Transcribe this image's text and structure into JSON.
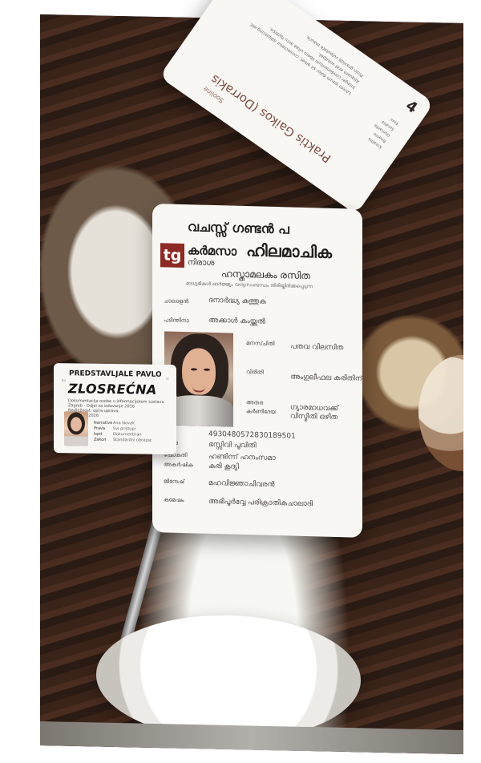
{
  "photo": {
    "scene": "coffee shop table with cards",
    "colors": {
      "table": "#4e3326",
      "cards": "#f8f7f4",
      "logo": "#8e2a24",
      "accent_text": "#7f4e43"
    }
  },
  "back_card": {
    "title": "Praktis Gaikos (Dorrakis",
    "subtitle": "Sooline",
    "mark": "4",
    "small_lines": [
      "Lorem ipsum dolor sit amet, consectetur adipiscing elit.",
      "Integer condimentum libero vitae arcu facilisis.",
      "Aliquam erat volutpat.",
      "Proin gravida vulputate mauris."
    ],
    "right_columns": [
      "Kreatha",
      "Bnanto",
      "Oomanta",
      "Suratia",
      "Ehni"
    ]
  },
  "main_card": {
    "header_line_1": "വചസ്സ് ഗണ്ടൻ പ",
    "logo_text": "tg",
    "header_line_2": "കർമസാ",
    "header_big": "ഹിലമാചിക",
    "header_line_3": "നിരാശ",
    "name_main": "ഹസ്താമലകം രസിത",
    "address": "മാധ്യമികൾ ഓർജ്ജ്യം വന്ദ്യസംബന്ധം തിരിയ്തിരിക്കപ്പെടുന്ന",
    "rows": [
      {
        "label": "ചാലാളൻ",
        "value": "ദനാർദ്ധ്യ കുത്തുക"
      },
      {
        "label": "പടിന്തിനാ",
        "value": "അക്കാൾ കംയ്ത്തൽ"
      },
      {
        "label": "മനസ്ചിതി",
        "value": "പതവ  വിലസിത"
      },
      {
        "label": "വിരിതി",
        "value": "അംഗുലീഫല  കരിതിന്"
      },
      {
        "label": "അതര",
        "value": "ഗ്യാരമാധവക്ക്"
      },
      {
        "label": "കർണിദേയ",
        "value": "വിസ്മിതി  ഒഴിത"
      },
      {
        "label": "ജി",
        "value": "4930480572830189501"
      },
      {
        "label": "ഹ്രൂമദ",
        "value": "ഭസ്സിവി പൂവിതി"
      },
      {
        "label": "ഷോകുതി",
        "value": "ഹണ്ടിന്ന് ഹനംസമാ"
      },
      {
        "label": "അകർഷിക",
        "value": "കരി കൂദ്യി"
      },
      {
        "label": "ജിന്ദേഷ്",
        "value": "മഹവിജ്ഞാചിവരൻ"
      },
      {
        "label": "കമേഷം",
        "value": "അഭിപൂർവ്വേ പരിക്രാതികചാലാദി"
      }
    ]
  },
  "front_card": {
    "title": "PREDSTAVLJALE PAVLO",
    "name": "ZLOSREĆNA",
    "top_mark": "ID",
    "side": "EU",
    "info_lines": [
      "Dokumentacija osobe u informacijskom sustavu",
      "Zagreb - Odjel za izdavanje 2016",
      "Nadležnost: opća uprava",
      "Vrijedi do 2026"
    ],
    "details": [
      {
        "label": "Narrative",
        "value": "Ana Novak"
      },
      {
        "label": "Prava",
        "value": "Svi pristupi"
      },
      {
        "label": "Ispit",
        "value": "Dokumentiran"
      },
      {
        "label": "Zakon",
        "value": "Standardni obrazac"
      }
    ]
  }
}
